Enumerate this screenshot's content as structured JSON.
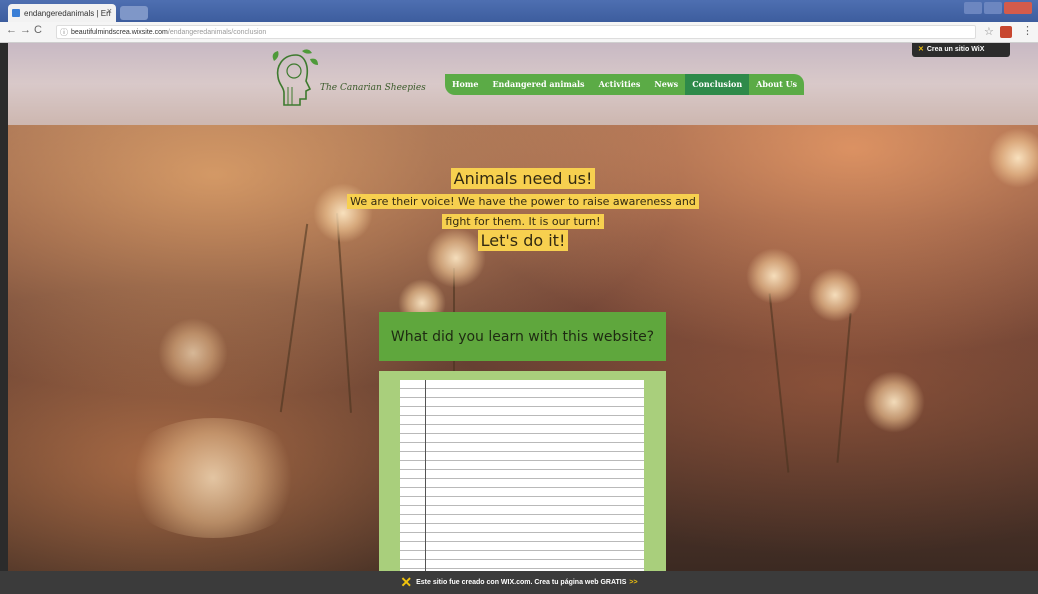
{
  "browser": {
    "tab_title": "endangeredanimals | En",
    "tab_close": "×",
    "url_host": "beautifulmindscrea.wixsite.com",
    "url_path": "/endangeredanimals/conclusion"
  },
  "site": {
    "title": "The Canarian Sheepies",
    "nav": [
      "Home",
      "Endangered animals",
      "Activities",
      "News",
      "Conclusion",
      "About Us"
    ],
    "active_nav": "Conclusion",
    "wix_badge": "Crea un sitio WiX"
  },
  "content": {
    "heading": "Animals need us!",
    "line1": "We are their voice! We have the power to raise awareness and",
    "line2": "fight for them. It is our turn!",
    "line3": "Let's do it!",
    "question": "What did you learn with this website?"
  },
  "footer": {
    "text": "Este sitio fue creado con WIX.com. Crea tu página web GRATIS",
    "arrow": ">>"
  },
  "colors": {
    "nav_green": "#5bab46",
    "nav_active": "#2e8a4a",
    "highlight": "#f7d04f",
    "question_bg": "#5fa73d"
  }
}
